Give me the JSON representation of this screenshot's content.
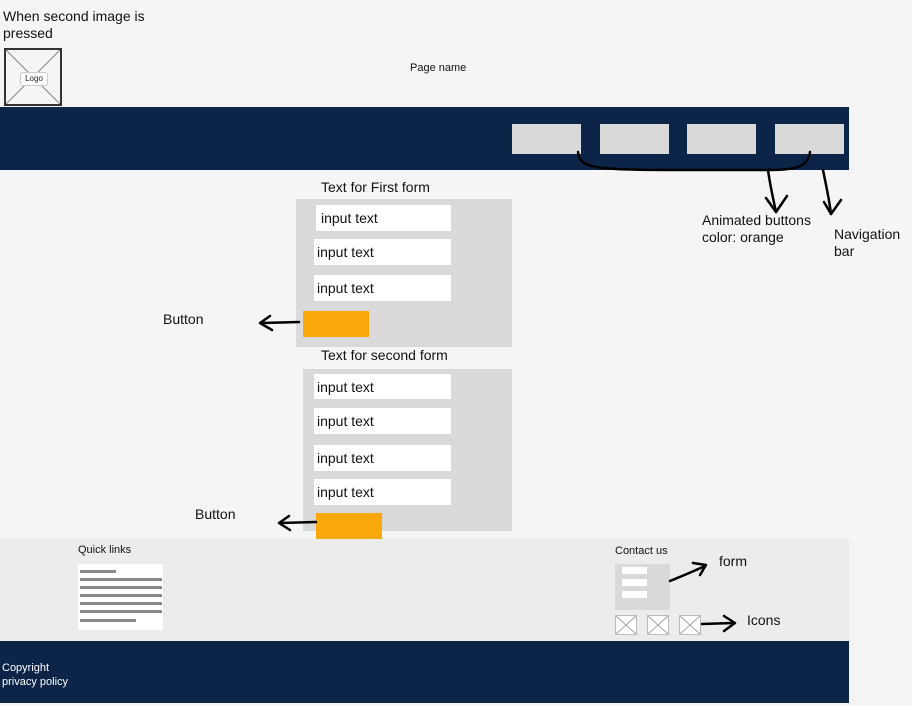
{
  "screen_title": "When second image is pressed",
  "logo": {
    "label": "Logo"
  },
  "page_name": "Page name",
  "nav": {
    "buttons": [
      "",
      "",
      "",
      ""
    ]
  },
  "annotations": {
    "animated_buttons": "Animated buttons color: orange",
    "navigation_bar": "Navigation bar",
    "button_1": "Button",
    "button_2": "Button",
    "form": "form",
    "icons": "Icons"
  },
  "form1": {
    "title": "Text for First form",
    "inputs": [
      "input text",
      "input text",
      "input text"
    ]
  },
  "form2": {
    "title": "Text for second form",
    "inputs": [
      "input text",
      "input text",
      "input text",
      "input text"
    ]
  },
  "footer": {
    "quick_links": "Quick links",
    "contact_us": "Contact us",
    "copyright": "Copyright",
    "privacy_policy": "privacy policy"
  },
  "colors": {
    "navy": "#0b2447",
    "orange": "#f9a80a",
    "placeholder_gray": "#d9d9d9"
  }
}
